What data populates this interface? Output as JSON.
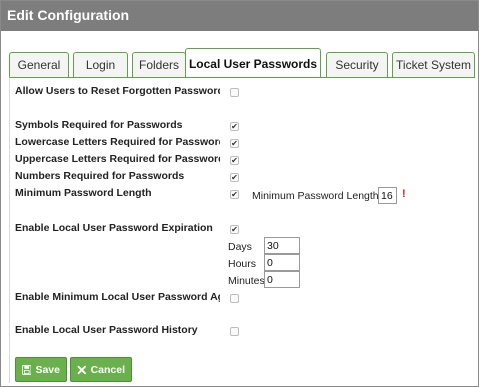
{
  "title": "Edit Configuration",
  "tabs": [
    {
      "label": "General"
    },
    {
      "label": "Login"
    },
    {
      "label": "Folders"
    },
    {
      "label": "Local User Passwords"
    },
    {
      "label": "Security"
    },
    {
      "label": "Ticket System"
    }
  ],
  "active_tab": "Local User Passwords",
  "settings": {
    "reset_forgotten": {
      "label": "Allow Users to Reset Forgotten Passwords",
      "checked": false
    },
    "symbols": {
      "label": "Symbols Required for Passwords",
      "checked": true
    },
    "lowercase": {
      "label": "Lowercase Letters Required for Passwords",
      "checked": true
    },
    "uppercase": {
      "label": "Uppercase Letters Required for Passwords",
      "checked": true
    },
    "numbers": {
      "label": "Numbers Required for Passwords",
      "checked": true
    },
    "min_length": {
      "label": "Minimum Password Length",
      "checked": true,
      "field_label": "Minimum Password Length",
      "value": "16",
      "warning": "!"
    },
    "expiration": {
      "label": "Enable Local User Password Expiration",
      "checked": true,
      "days_label": "Days",
      "days_value": "30",
      "hours_label": "Hours",
      "hours_value": "0",
      "minutes_label": "Minutes",
      "minutes_value": "0"
    },
    "min_age": {
      "label": "Enable Minimum Local User Password Age",
      "checked": false
    },
    "history": {
      "label": "Enable Local User Password History",
      "checked": false
    }
  },
  "buttons": {
    "save": "Save",
    "cancel": "Cancel"
  },
  "colors": {
    "accent": "#6ab04c",
    "titlebar": "#7d7d7d",
    "warning": "#d21e1e"
  }
}
